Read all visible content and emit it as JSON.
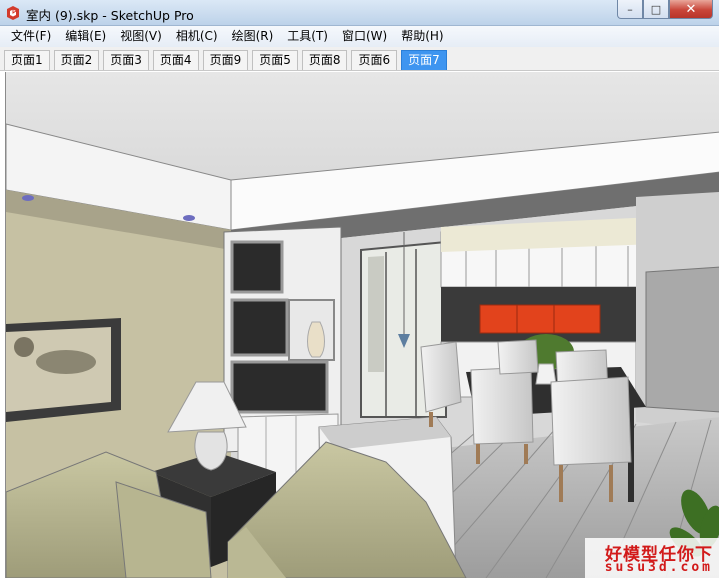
{
  "window": {
    "title": "室内 (9).skp - SketchUp Pro",
    "buttons": {
      "minimize": "–",
      "maximize": "□",
      "close": "✕"
    }
  },
  "menu": {
    "items": [
      "文件(F)",
      "编辑(E)",
      "视图(V)",
      "相机(C)",
      "绘图(R)",
      "工具(T)",
      "窗口(W)",
      "帮助(H)"
    ]
  },
  "scene_tabs": {
    "items": [
      "页面1",
      "页面2",
      "页面3",
      "页面4",
      "页面9",
      "页面5",
      "页面8",
      "页面6",
      "页面7"
    ],
    "active_index": 8
  },
  "watermark": {
    "line1": "好模型任你下",
    "line2": "susu3d.com"
  },
  "colors": {
    "active_tab": "#3e95f0",
    "accent_red": "#e2431c",
    "watermark": "#d21a1a"
  },
  "icons": {
    "app": "sketchup-logo-icon"
  }
}
